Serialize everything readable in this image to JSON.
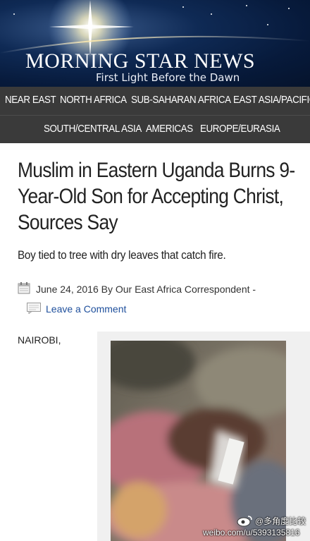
{
  "site": {
    "logo_title": "MORNING STAR NEWS",
    "logo_tagline": "First Light Before the Dawn"
  },
  "nav": {
    "row1": [
      "NEAR EAST",
      "NORTH AFRICA",
      "SUB-SAHARAN AFRICA",
      "EAST ASIA/PACIFIC"
    ],
    "row2": [
      "SOUTH/CENTRAL ASIA",
      "AMERICAS",
      "EUROPE/EURASIA"
    ]
  },
  "article": {
    "headline": "Muslim in Eastern Uganda Burns 9-Year-Old Son for Accepting Christ, Sources Say",
    "deck": "Boy tied to tree with dry leaves that catch fire.",
    "meta": "June 24, 2016 By Our East Africa Correspondent -",
    "comment_link": "Leave a Comment",
    "dateline": "NAIROBI,"
  },
  "watermark": {
    "handle": "@多角度比较",
    "url": "weibo.com/u/5393135816"
  },
  "icons": {
    "calendar": "calendar-icon",
    "comment": "comment-icon",
    "weibo": "weibo-icon"
  },
  "colors": {
    "nav_bg": "#3a3a3a",
    "banner_bg": "#0f2a55",
    "link": "#1e4f9c"
  }
}
